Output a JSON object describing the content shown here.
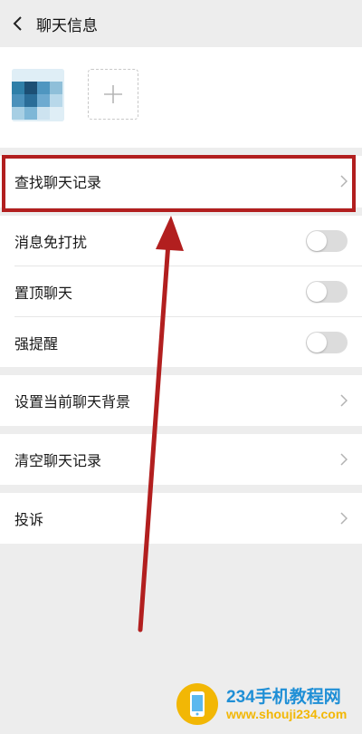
{
  "header": {
    "title": "聊天信息",
    "back_icon": "chevron-left-icon"
  },
  "members": {
    "add_icon": "plus-icon"
  },
  "rows": {
    "search_history": "查找聊天记录",
    "mute": "消息免打扰",
    "pin": "置顶聊天",
    "strong_remind": "强提醒",
    "set_background": "设置当前聊天背景",
    "clear_history": "清空聊天记录",
    "report": "投诉"
  },
  "toggles": {
    "mute_on": false,
    "pin_on": false,
    "strong_remind_on": false
  },
  "watermark": {
    "title": "234手机教程网",
    "url": "www.shouji234.com"
  },
  "colors": {
    "annotation": "#b21f1f",
    "toggle_off": "#dcdcdc",
    "watermark_blue": "#1f8fd6",
    "watermark_yellow": "#f2b705"
  }
}
